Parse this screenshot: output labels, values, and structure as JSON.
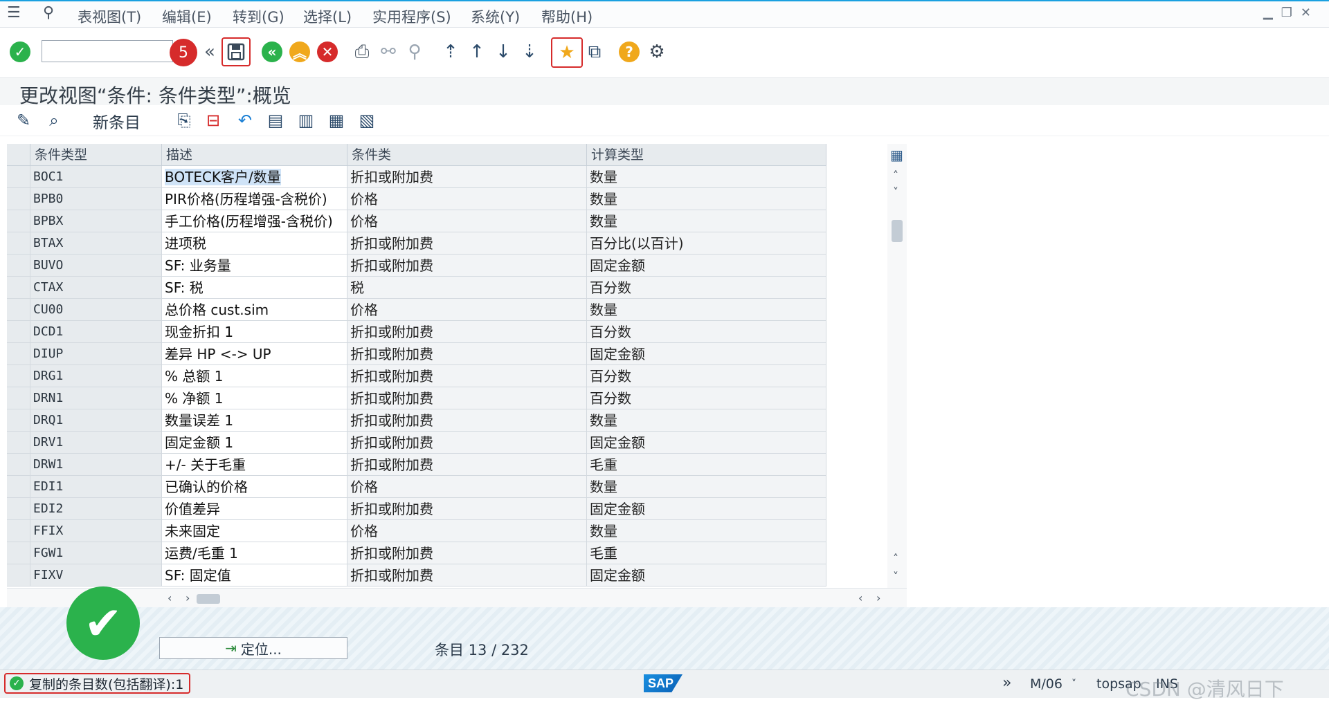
{
  "menubar": {
    "items": [
      "表视图(T)",
      "编辑(E)",
      "转到(G)",
      "选择(L)",
      "实用程序(S)",
      "系统(Y)",
      "帮助(H)"
    ]
  },
  "toolbar": {
    "step_badge": "5"
  },
  "title": "更改视图“条件: 条件类型”:概览",
  "app_toolbar": {
    "new_entries": "新条目"
  },
  "table": {
    "columns": [
      "条件类型",
      "描述",
      "条件类",
      "计算类型"
    ],
    "rows": [
      {
        "key": "BOC1",
        "desc": "BOTECK客户/数量",
        "cls": "折扣或附加费",
        "calc": "数量"
      },
      {
        "key": "BPB0",
        "desc": "PIR价格(历程增强-含税价)",
        "cls": "价格",
        "calc": "数量"
      },
      {
        "key": "BPBX",
        "desc": "手工价格(历程增强-含税价)",
        "cls": "价格",
        "calc": "数量"
      },
      {
        "key": "BTAX",
        "desc": "进项税",
        "cls": "折扣或附加费",
        "calc": "百分比(以百计)"
      },
      {
        "key": "BUVO",
        "desc": "SF: 业务量",
        "cls": "折扣或附加费",
        "calc": "固定金额"
      },
      {
        "key": "CTAX",
        "desc": "SF: 税",
        "cls": "税",
        "calc": "百分数"
      },
      {
        "key": "CU00",
        "desc": "总价格 cust.sim",
        "cls": "价格",
        "calc": "数量"
      },
      {
        "key": "DCD1",
        "desc": "现金折扣 1",
        "cls": "折扣或附加费",
        "calc": "百分数"
      },
      {
        "key": "DIUP",
        "desc": "差异 HP <-> UP",
        "cls": "折扣或附加费",
        "calc": "固定金额"
      },
      {
        "key": "DRG1",
        "desc": "% 总额 1",
        "cls": "折扣或附加费",
        "calc": "百分数"
      },
      {
        "key": "DRN1",
        "desc": "% 净额 1",
        "cls": "折扣或附加费",
        "calc": "百分数"
      },
      {
        "key": "DRQ1",
        "desc": "数量误差 1",
        "cls": "折扣或附加费",
        "calc": "数量"
      },
      {
        "key": "DRV1",
        "desc": "固定金额 1",
        "cls": "折扣或附加费",
        "calc": "固定金额"
      },
      {
        "key": "DRW1",
        "desc": "+/- 关于毛重",
        "cls": "折扣或附加费",
        "calc": "毛重"
      },
      {
        "key": "EDI1",
        "desc": "已确认的价格",
        "cls": "价格",
        "calc": "数量"
      },
      {
        "key": "EDI2",
        "desc": "价值差异",
        "cls": "折扣或附加费",
        "calc": "固定金额"
      },
      {
        "key": "FFIX",
        "desc": "未来固定",
        "cls": "价格",
        "calc": "数量"
      },
      {
        "key": "FGW1",
        "desc": "运费/毛重 1",
        "cls": "折扣或附加费",
        "calc": "毛重"
      },
      {
        "key": "FIXV",
        "desc": "SF: 固定值",
        "cls": "折扣或附加费",
        "calc": "固定金额"
      }
    ]
  },
  "position_button": "定位...",
  "entry_counter": "条目 13 / 232",
  "statusbar": {
    "message": "复制的条目数(包括翻译):1",
    "sap_logo": "SAP",
    "session": "M/06",
    "server": "topsap",
    "mode": "INS",
    "watermark": "CSDN @清风日下"
  },
  "colors": {
    "accent_blue": "#1aa0e0",
    "ok_green": "#2bb24c",
    "highlight_red": "#d62b2b",
    "selection": "#cfe3f7"
  },
  "icons": [
    "menu-icon",
    "pin-icon",
    "check-icon",
    "back-double-icon",
    "save-icon",
    "nav-back-icon",
    "exit-icon",
    "cancel-icon",
    "print-icon",
    "find-icon",
    "find-next-icon",
    "first-page-icon",
    "prev-page-icon",
    "next-page-icon",
    "last-page-icon",
    "create-session-icon",
    "shortcut-icon",
    "help-icon",
    "settings-icon"
  ]
}
